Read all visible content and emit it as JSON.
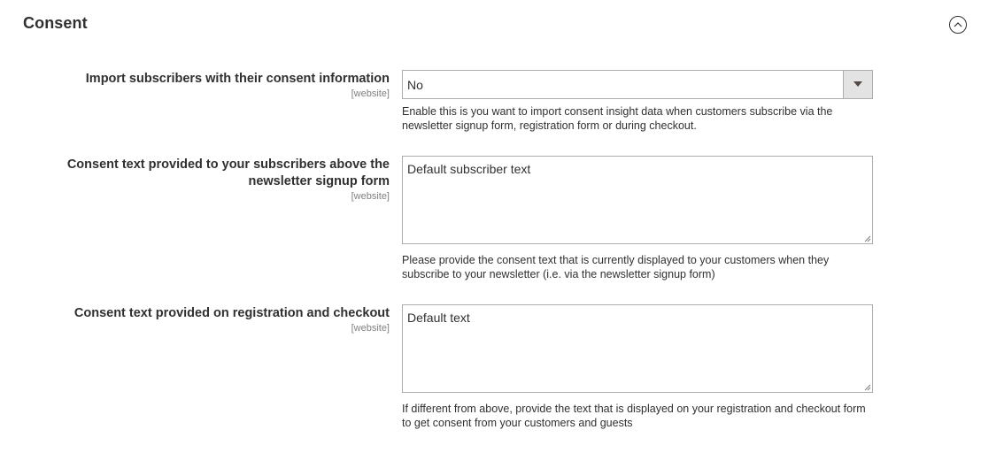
{
  "section": {
    "title": "Consent",
    "collapse_icon": "chevron-up-circle-icon"
  },
  "fields": [
    {
      "label": "Import subscribers with their consent information",
      "scope": "[website]",
      "type": "select",
      "value": "No",
      "note": "Enable this is you want to import consent insight data when customers subscribe via the newsletter signup form, registration form or during checkout."
    },
    {
      "label_line1": "Consent text provided to your subscribers above the",
      "label_line2": "newsletter signup form",
      "scope": "[website]",
      "type": "textarea",
      "value": "Default subscriber text",
      "note": "Please provide the consent text that is currently displayed to your customers when they subscribe to your newsletter (i.e. via the newsletter signup form)"
    },
    {
      "label": "Consent text provided on registration and checkout",
      "scope": "[website]",
      "type": "textarea",
      "value": "Default text",
      "note": "If different from above, provide the text that is displayed on your registration and checkout form to get consent from your customers and guests"
    }
  ]
}
